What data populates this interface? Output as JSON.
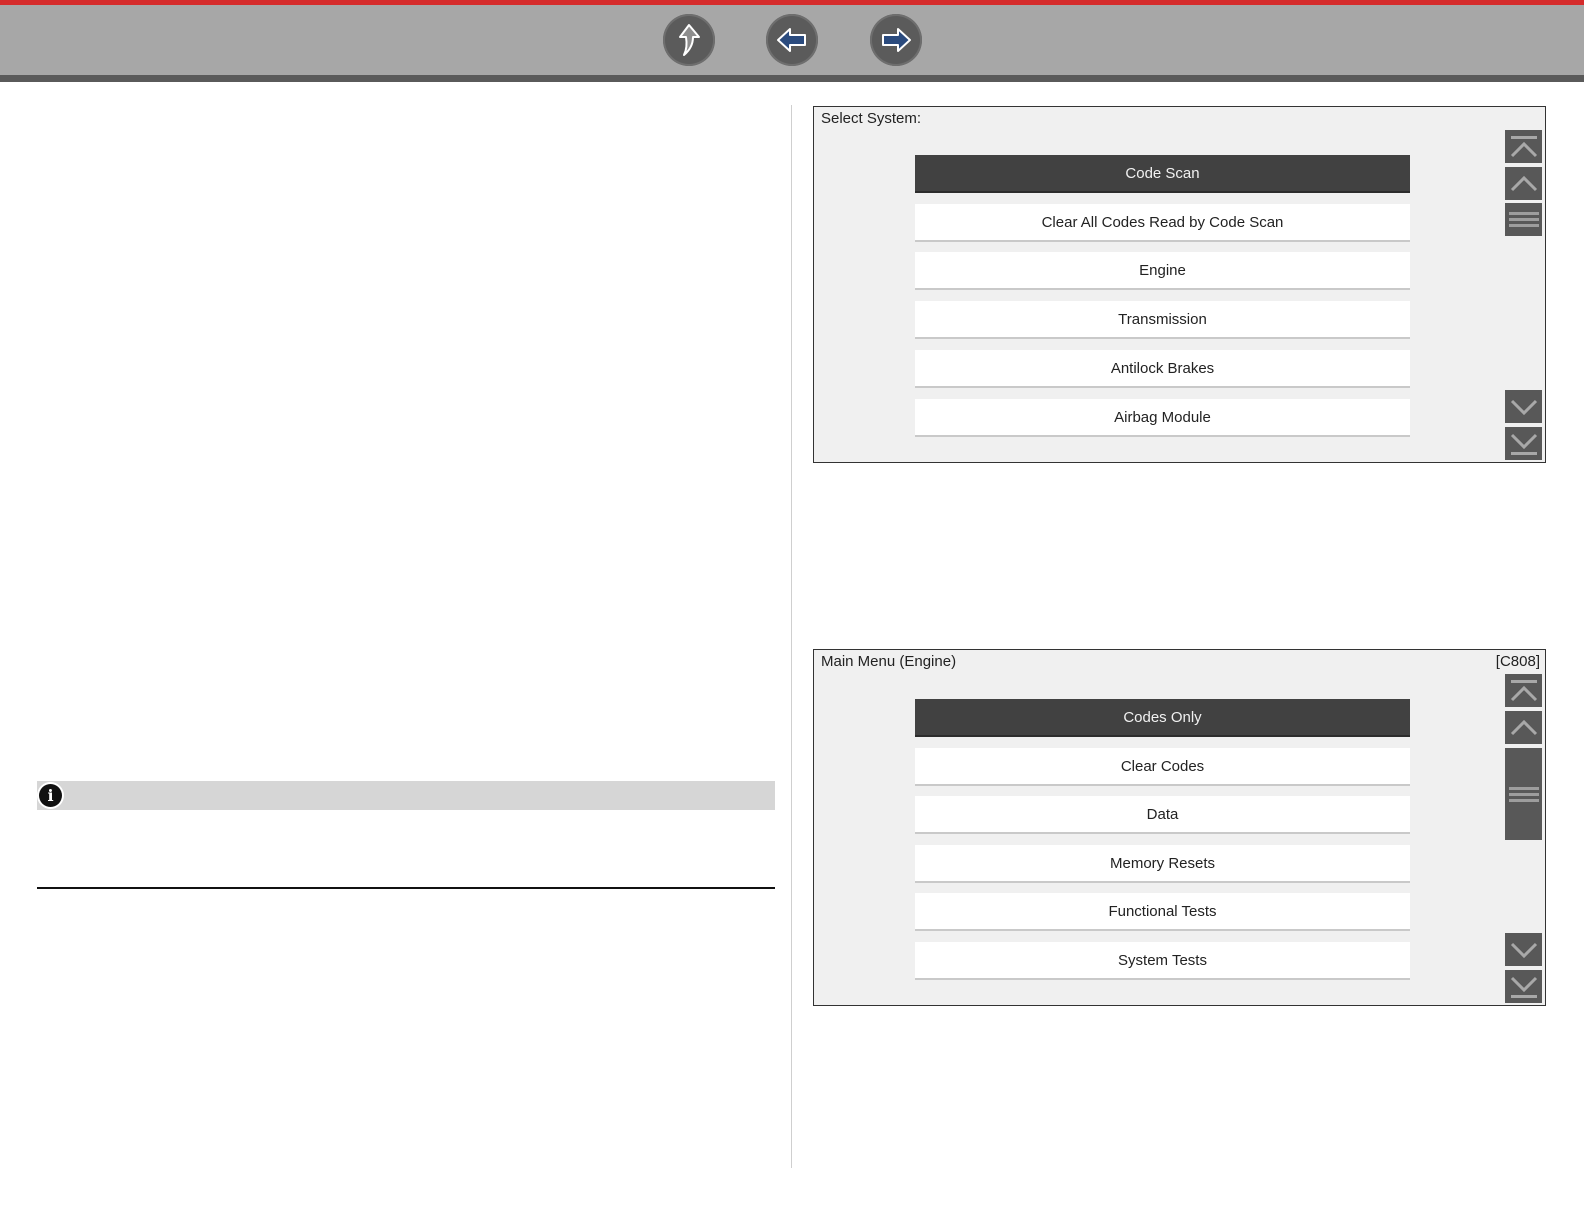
{
  "nav": {
    "buttons": [
      {
        "name": "home-up",
        "icon": "curved-up-arrow-icon"
      },
      {
        "name": "back",
        "icon": "left-arrow-icon"
      },
      {
        "name": "forward",
        "icon": "right-arrow-icon"
      }
    ],
    "colors": {
      "bar": "#a7a7a7",
      "accent": "#d52b2b",
      "button": "#5b5b5b",
      "arrow_fill": "#2b4b7e"
    }
  },
  "note": {
    "icon": "info-icon",
    "icon_glyph": "i"
  },
  "screen1": {
    "title": "Select System:",
    "items": [
      "Code Scan",
      "Clear All Codes Read by Code Scan",
      "Engine",
      "Transmission",
      "Antilock Brakes",
      "Airbag Module"
    ],
    "selected_index": 0
  },
  "screen2": {
    "title": "Main Menu (Engine)",
    "code": "[C808]",
    "items": [
      "Codes Only",
      "Clear Codes",
      "Data",
      "Memory Resets",
      "Functional Tests",
      "System Tests"
    ],
    "selected_index": 0
  },
  "scrollbar_icons": [
    "scroll-top-icon",
    "scroll-up-icon",
    "scroll-thumb-icon",
    "scroll-down-icon",
    "scroll-bottom-icon"
  ]
}
